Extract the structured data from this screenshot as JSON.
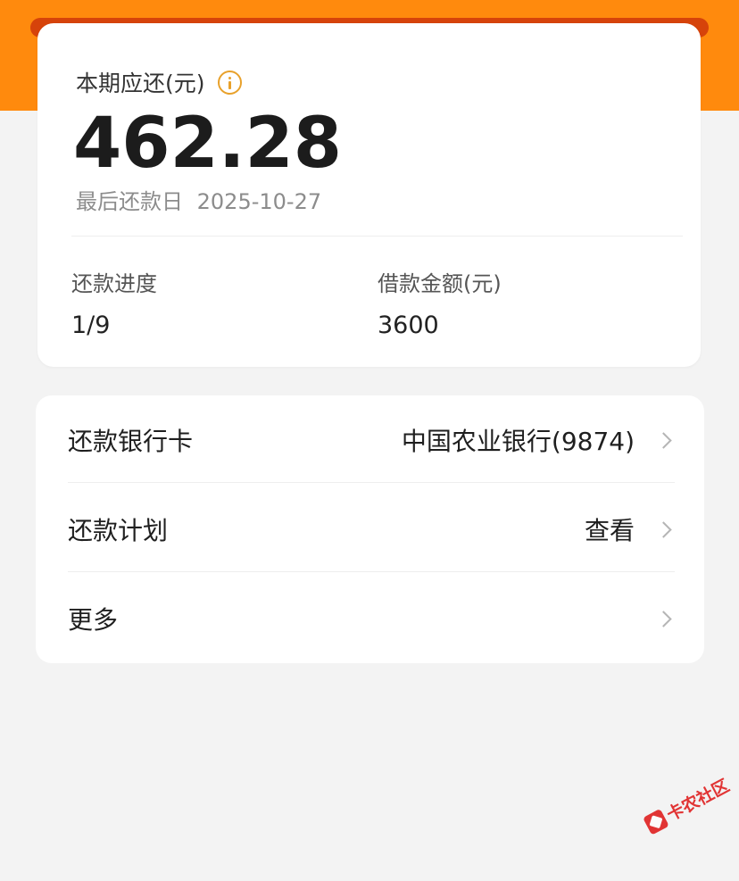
{
  "summary": {
    "due_label": "本期应还(元)",
    "info_icon": "info-circle-icon",
    "due_amount": "462.28",
    "last_date_label": "最后还款日",
    "last_date": "2025-10-27",
    "progress_label": "还款进度",
    "progress_value": "1/9",
    "loan_label": "借款金额(元)",
    "loan_value": "3600"
  },
  "options": [
    {
      "label": "还款银行卡",
      "value": "中国农业银行(9874)"
    },
    {
      "label": "还款计划",
      "value": "查看"
    },
    {
      "label": "更多",
      "value": ""
    }
  ],
  "watermark": {
    "text": "卡农社区"
  },
  "colors": {
    "header": "#ff8a0d",
    "info_icon": "#e8a12b",
    "watermark": "#e02020"
  }
}
